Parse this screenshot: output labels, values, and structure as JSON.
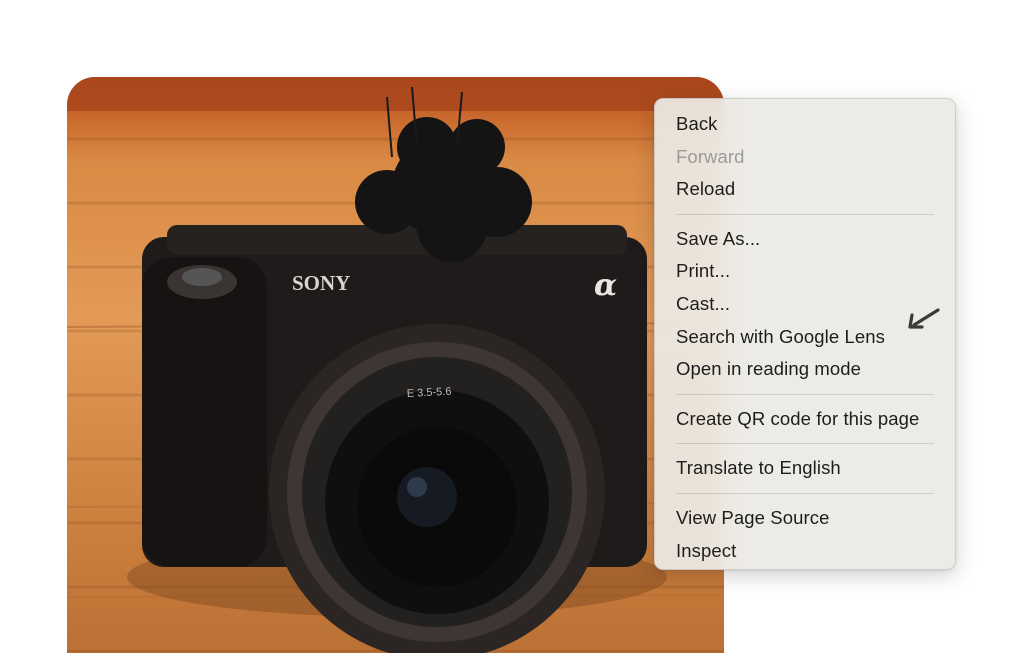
{
  "photo": {
    "description_icon": "camera-photo",
    "brand_text": "SONY",
    "logo_text": "α"
  },
  "context_menu": {
    "groups": [
      [
        {
          "label": "Back",
          "enabled": true
        },
        {
          "label": "Forward",
          "enabled": false
        },
        {
          "label": "Reload",
          "enabled": true
        }
      ],
      [
        {
          "label": "Save As...",
          "enabled": true
        },
        {
          "label": "Print...",
          "enabled": true
        },
        {
          "label": "Cast...",
          "enabled": true
        },
        {
          "label": "Search with Google Lens",
          "enabled": true
        },
        {
          "label": "Open in reading mode",
          "enabled": true
        }
      ],
      [
        {
          "label": "Create QR code for this page",
          "enabled": true
        }
      ],
      [
        {
          "label": "Translate to English",
          "enabled": true
        }
      ],
      [
        {
          "label": "View Page Source",
          "enabled": true
        },
        {
          "label": "Inspect",
          "enabled": true
        }
      ]
    ]
  },
  "annotation": {
    "icon": "arrow-pointer-icon",
    "points_to": "Search with Google Lens"
  },
  "colors": {
    "menu_background": "#ECE9E4",
    "menu_text": "#1D1D1D",
    "menu_disabled_text": "#9A9A9A",
    "wood": "#E39A57",
    "camera_body": "#1E1B1A"
  }
}
